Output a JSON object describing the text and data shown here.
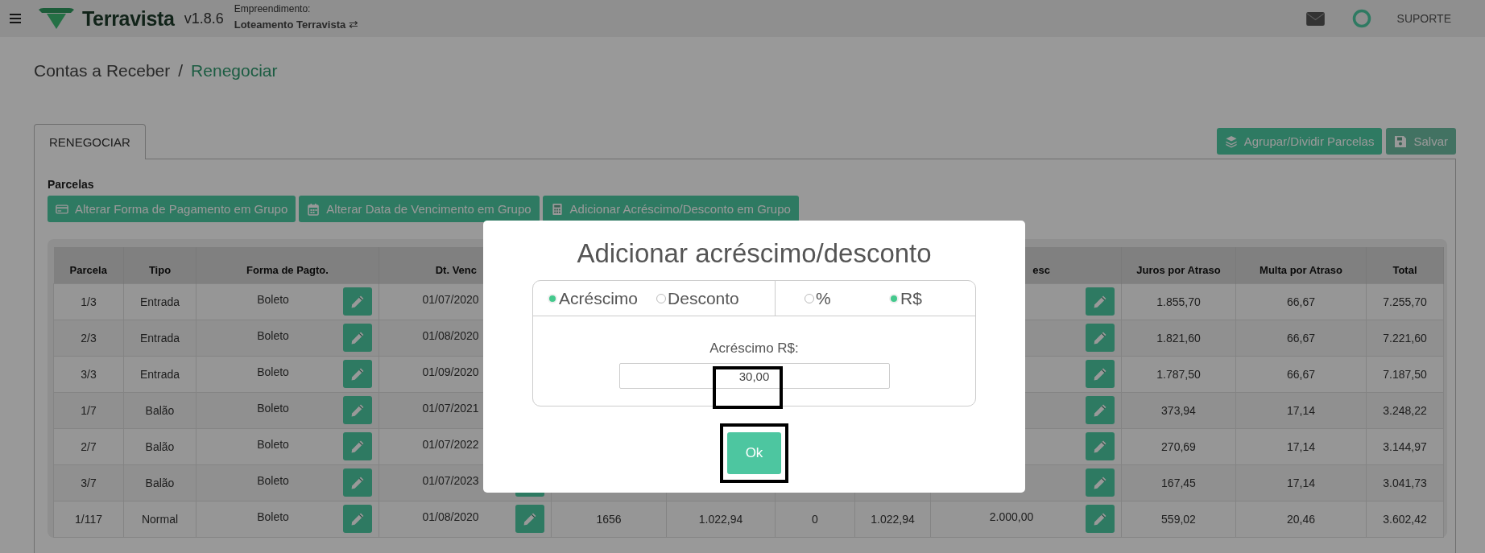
{
  "topbar": {
    "brand": "Terravista",
    "version": "v1.8.6",
    "project_label": "Empreendimento:",
    "project_name": "Loteamento Terravista",
    "switch_glyph": "⇄",
    "support": "SUPORTE"
  },
  "breadcrumb": {
    "parent": "Contas a Receber",
    "separator": "/",
    "current": "Renegociar"
  },
  "tabs": [
    {
      "label": "RENEGOCIAR",
      "selected": true
    }
  ],
  "actions": [
    {
      "label": "Agrupar/Dividir Parcelas",
      "disabled": false
    },
    {
      "label": "Salvar",
      "disabled": true
    }
  ],
  "section_title": "Parcelas",
  "group_buttons": [
    {
      "label": "Alterar Forma de Pagamento em Grupo"
    },
    {
      "label": "Alterar Data de Vencimento em Grupo"
    },
    {
      "label": "Adicionar Acréscimo/Desconto em Grupo"
    }
  ],
  "table": {
    "columns": [
      {
        "label": "Parcela"
      },
      {
        "label": "Tipo"
      },
      {
        "label": "Forma de Pagto."
      },
      {
        "label": "Dt. Venc"
      },
      {},
      {},
      {},
      {},
      {
        "label": "esc"
      },
      {
        "label": "Juros por Atraso"
      },
      {
        "label": "Multa por Atraso"
      },
      {
        "label": "Total"
      }
    ],
    "rows": [
      {
        "cells": [
          {
            "text": "1/3"
          },
          {
            "text": "Entrada"
          },
          {
            "text": "Boleto",
            "edit": true
          },
          {
            "text": "01/07/2020",
            "edit": false
          },
          {},
          {},
          {},
          {},
          {
            "edit": true
          },
          {
            "text": "1.855,70"
          },
          {
            "text": "66,67"
          },
          {
            "text": "7.255,70"
          }
        ]
      },
      {
        "cells": [
          {
            "text": "2/3"
          },
          {
            "text": "Entrada"
          },
          {
            "text": "Boleto",
            "edit": true
          },
          {
            "text": "01/08/2020",
            "edit": false
          },
          {},
          {},
          {},
          {},
          {
            "edit": true
          },
          {
            "text": "1.821,60"
          },
          {
            "text": "66,67"
          },
          {
            "text": "7.221,60"
          }
        ]
      },
      {
        "cells": [
          {
            "text": "3/3"
          },
          {
            "text": "Entrada"
          },
          {
            "text": "Boleto",
            "edit": true
          },
          {
            "text": "01/09/2020",
            "edit": false
          },
          {},
          {},
          {},
          {},
          {
            "edit": true
          },
          {
            "text": "1.787,50"
          },
          {
            "text": "66,67"
          },
          {
            "text": "7.187,50"
          }
        ]
      },
      {
        "cells": [
          {
            "text": "1/7"
          },
          {
            "text": "Balão"
          },
          {
            "text": "Boleto",
            "edit": true
          },
          {
            "text": "01/07/2021",
            "edit": false
          },
          {},
          {},
          {},
          {},
          {
            "edit": true
          },
          {
            "text": "373,94"
          },
          {
            "text": "17,14"
          },
          {
            "text": "3.248,22"
          }
        ]
      },
      {
        "cells": [
          {
            "text": "2/7"
          },
          {
            "text": "Balão"
          },
          {
            "text": "Boleto",
            "edit": true
          },
          {
            "text": "01/07/2022",
            "edit": false
          },
          {},
          {},
          {},
          {},
          {
            "edit": true
          },
          {
            "text": "270,69"
          },
          {
            "text": "17,14"
          },
          {
            "text": "3.144,97"
          }
        ]
      },
      {
        "cells": [
          {
            "text": "3/7"
          },
          {
            "text": "Balão"
          },
          {
            "text": "Boleto",
            "edit": true
          },
          {
            "text": "01/07/2023",
            "edit": true
          },
          {},
          {},
          {},
          {},
          {
            "edit": true
          },
          {
            "text": "167,45"
          },
          {
            "text": "17,14"
          },
          {
            "text": "3.041,73"
          }
        ]
      },
      {
        "cells": [
          {
            "text": "1/117"
          },
          {
            "text": "Normal"
          },
          {
            "text": "Boleto",
            "edit": true
          },
          {
            "text": "01/08/2020",
            "edit": true
          },
          {
            "text": "1656"
          },
          {
            "text": "1.022,94"
          },
          {
            "text": "0"
          },
          {
            "text": "1.022,94"
          },
          {
            "text": "2.000,00",
            "edit": true
          },
          {
            "text": "559,02"
          },
          {
            "text": "20,46"
          },
          {
            "text": "3.602,42"
          }
        ]
      }
    ]
  },
  "modal": {
    "title": "Adicionar acréscimo/desconto",
    "type_options": [
      {
        "label": "Acréscimo",
        "selected": true
      },
      {
        "label": "Desconto",
        "selected": false
      }
    ],
    "unit_options": [
      {
        "label": "%",
        "selected": false
      },
      {
        "label": "R$",
        "selected": true
      }
    ],
    "field_label": "Acréscimo R$:",
    "value": "30,00",
    "ok": "Ok"
  }
}
